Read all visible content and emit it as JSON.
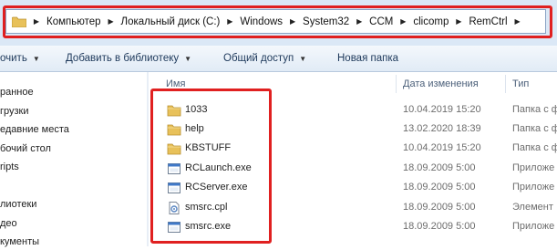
{
  "address_bar": {
    "crumbs": [
      "Компьютер",
      "Локальный диск (C:)",
      "Windows",
      "System32",
      "CCM",
      "clicomp",
      "RemCtrl"
    ]
  },
  "toolbar": {
    "organize_label": "очить",
    "add_to_library_label": "Добавить в библиотеку",
    "share_label": "Общий доступ",
    "new_folder_label": "Новая папка"
  },
  "nav_pane": {
    "items": [
      "ранное",
      "грузки",
      "едавние места",
      "бочий стол",
      "ripts",
      "",
      "лиотеки",
      "део",
      "кументы"
    ]
  },
  "columns": {
    "name": "Имя",
    "date": "Дата изменения",
    "type": "Тип"
  },
  "files": [
    {
      "name": "1033",
      "date": "10.04.2019 15:20",
      "type": "Папка с ф",
      "icon": "folder-icon"
    },
    {
      "name": "help",
      "date": "13.02.2020 18:39",
      "type": "Папка с ф",
      "icon": "folder-icon"
    },
    {
      "name": "KBSTUFF",
      "date": "10.04.2019 15:20",
      "type": "Папка с ф",
      "icon": "folder-icon"
    },
    {
      "name": "RCLaunch.exe",
      "date": "18.09.2009 5:00",
      "type": "Приложе",
      "icon": "exe-icon"
    },
    {
      "name": "RCServer.exe",
      "date": "18.09.2009 5:00",
      "type": "Приложе",
      "icon": "exe-icon"
    },
    {
      "name": "smsrc.cpl",
      "date": "18.09.2009 5:00",
      "type": "Элемент",
      "icon": "cpl-icon"
    },
    {
      "name": "smsrc.exe",
      "date": "18.09.2009 5:00",
      "type": "Приложе",
      "icon": "exe-icon"
    }
  ],
  "colors": {
    "annotation_red": "#e02020",
    "toolbar_text": "#1e395b",
    "folder_yellow": "#e8c15a"
  }
}
